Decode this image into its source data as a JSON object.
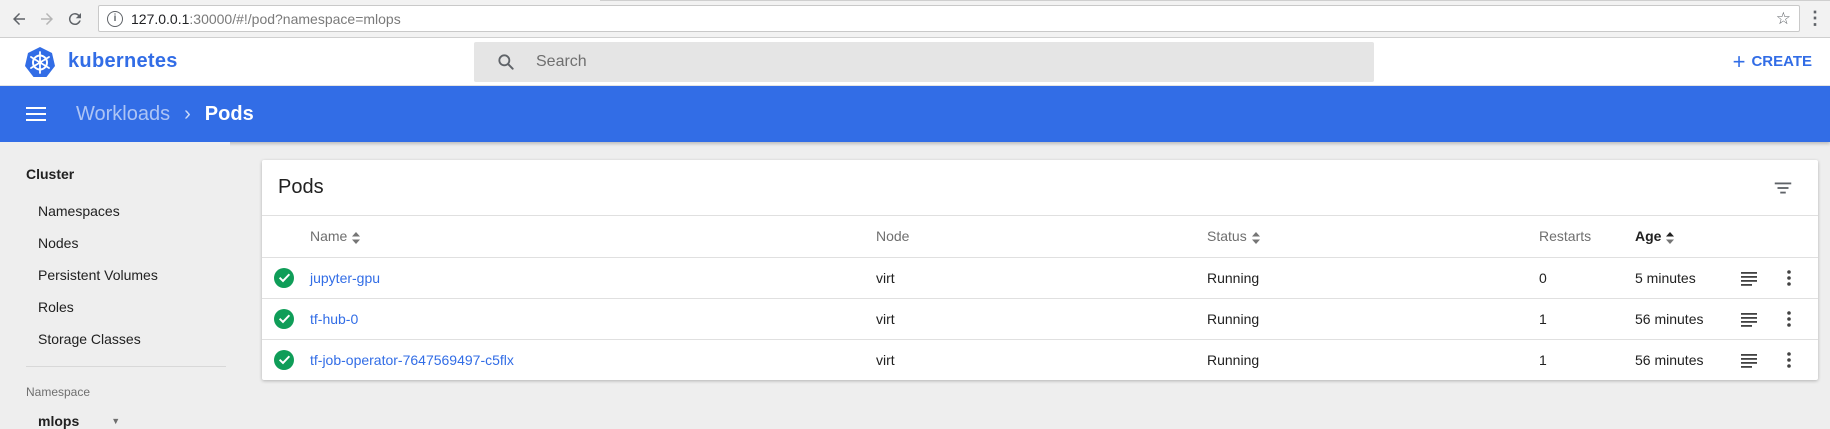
{
  "browser": {
    "url_host": "127.0.0.1",
    "url_rest": ":30000/#!/pod?namespace=mlops"
  },
  "toolbar": {
    "brand": "kubernetes",
    "search_placeholder": "Search",
    "create_label": "CREATE"
  },
  "breadcrumb": {
    "parent": "Workloads",
    "current": "Pods"
  },
  "sidebar": {
    "section_title": "Cluster",
    "items": [
      {
        "label": "Namespaces"
      },
      {
        "label": "Nodes"
      },
      {
        "label": "Persistent Volumes"
      },
      {
        "label": "Roles"
      },
      {
        "label": "Storage Classes"
      }
    ],
    "namespace_label": "Namespace",
    "namespace_value": "mlops"
  },
  "card": {
    "title": "Pods",
    "columns": {
      "name": "Name",
      "node": "Node",
      "status": "Status",
      "restarts": "Restarts",
      "age": "Age"
    },
    "rows": [
      {
        "name": "jupyter-gpu",
        "node": "virt",
        "status": "Running",
        "restarts": "0",
        "age": "5 minutes"
      },
      {
        "name": "tf-hub-0",
        "node": "virt",
        "status": "Running",
        "restarts": "1",
        "age": "56 minutes"
      },
      {
        "name": "tf-job-operator-7647569497-c5flx",
        "node": "virt",
        "status": "Running",
        "restarts": "1",
        "age": "56 minutes"
      }
    ]
  },
  "colors": {
    "brand_blue": "#326de6",
    "status_ok": "#0f9d58"
  }
}
